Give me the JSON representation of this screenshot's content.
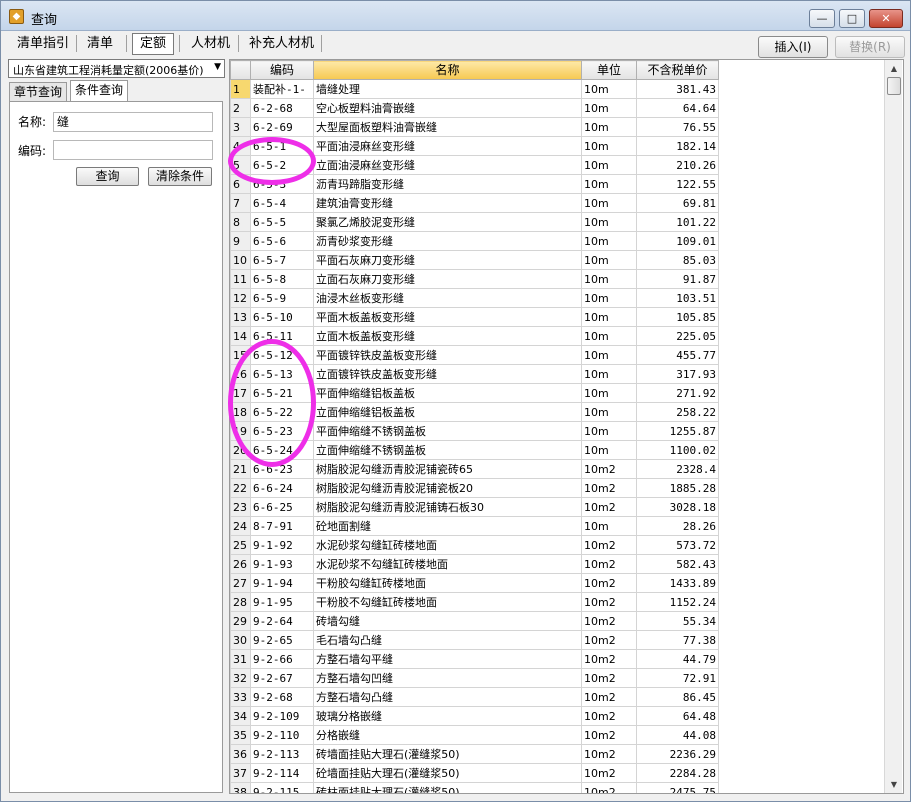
{
  "window": {
    "title": "查询",
    "buttons": {
      "minimize": "—",
      "maximize": "□",
      "close": "✕"
    }
  },
  "toolbar": {
    "tabs": [
      "清单指引",
      "清单",
      "定额",
      "人材机",
      "补充人材机"
    ],
    "active_tab": "定额",
    "insert_label": "插入(I)",
    "replace_label": "替换(R)"
  },
  "left": {
    "library_select": "山东省建筑工程消耗量定额(2006基价)",
    "subtabs": [
      "章节查询",
      "条件查询"
    ],
    "active_subtab": "条件查询",
    "name_label": "名称:",
    "name_value": "缝",
    "code_label": "编码:",
    "code_value": "",
    "query_button": "查询",
    "clear_button": "清除条件"
  },
  "grid": {
    "columns": [
      "",
      "编码",
      "名称",
      "单位",
      "不含税单价"
    ],
    "sorted_column": "名称",
    "rows": [
      {
        "no": "1",
        "code": "装配补-1-",
        "name": "墙缝处理",
        "unit": "10m",
        "price": "381.43"
      },
      {
        "no": "2",
        "code": "6-2-68",
        "name": "空心板塑料油膏嵌缝",
        "unit": "10m",
        "price": "64.64"
      },
      {
        "no": "3",
        "code": "6-2-69",
        "name": "大型屋面板塑料油膏嵌缝",
        "unit": "10m",
        "price": "76.55"
      },
      {
        "no": "4",
        "code": "6-5-1",
        "name": "平面油浸麻丝变形缝",
        "unit": "10m",
        "price": "182.14"
      },
      {
        "no": "5",
        "code": "6-5-2",
        "name": "立面油浸麻丝变形缝",
        "unit": "10m",
        "price": "210.26"
      },
      {
        "no": "6",
        "code": "6-5-3",
        "name": "沥青玛蹄脂变形缝",
        "unit": "10m",
        "price": "122.55"
      },
      {
        "no": "7",
        "code": "6-5-4",
        "name": "建筑油膏变形缝",
        "unit": "10m",
        "price": "69.81"
      },
      {
        "no": "8",
        "code": "6-5-5",
        "name": "聚氯乙烯胶泥变形缝",
        "unit": "10m",
        "price": "101.22"
      },
      {
        "no": "9",
        "code": "6-5-6",
        "name": "沥青砂浆变形缝",
        "unit": "10m",
        "price": "109.01"
      },
      {
        "no": "10",
        "code": "6-5-7",
        "name": "平面石灰麻刀变形缝",
        "unit": "10m",
        "price": "85.03"
      },
      {
        "no": "11",
        "code": "6-5-8",
        "name": "立面石灰麻刀变形缝",
        "unit": "10m",
        "price": "91.87"
      },
      {
        "no": "12",
        "code": "6-5-9",
        "name": "油浸木丝板变形缝",
        "unit": "10m",
        "price": "103.51"
      },
      {
        "no": "13",
        "code": "6-5-10",
        "name": "平面木板盖板变形缝",
        "unit": "10m",
        "price": "105.85"
      },
      {
        "no": "14",
        "code": "6-5-11",
        "name": "立面木板盖板变形缝",
        "unit": "10m",
        "price": "225.05"
      },
      {
        "no": "15",
        "code": "6-5-12",
        "name": "平面镀锌铁皮盖板变形缝",
        "unit": "10m",
        "price": "455.77"
      },
      {
        "no": "16",
        "code": "6-5-13",
        "name": "立面镀锌铁皮盖板变形缝",
        "unit": "10m",
        "price": "317.93"
      },
      {
        "no": "17",
        "code": "6-5-21",
        "name": "平面伸缩缝铝板盖板",
        "unit": "10m",
        "price": "271.92"
      },
      {
        "no": "18",
        "code": "6-5-22",
        "name": "立面伸缩缝铝板盖板",
        "unit": "10m",
        "price": "258.22"
      },
      {
        "no": "19",
        "code": "6-5-23",
        "name": "平面伸缩缝不锈钢盖板",
        "unit": "10m",
        "price": "1255.87"
      },
      {
        "no": "20",
        "code": "6-5-24",
        "name": "立面伸缩缝不锈钢盖板",
        "unit": "10m",
        "price": "1100.02"
      },
      {
        "no": "21",
        "code": "6-6-23",
        "name": "树脂胶泥勾缝沥青胶泥铺瓷砖65",
        "unit": "10m2",
        "price": "2328.4"
      },
      {
        "no": "22",
        "code": "6-6-24",
        "name": "树脂胶泥勾缝沥青胶泥铺瓷板20",
        "unit": "10m2",
        "price": "1885.28"
      },
      {
        "no": "23",
        "code": "6-6-25",
        "name": "树脂胶泥勾缝沥青胶泥铺铸石板30",
        "unit": "10m2",
        "price": "3028.18"
      },
      {
        "no": "24",
        "code": "8-7-91",
        "name": "砼地面割缝",
        "unit": "10m",
        "price": "28.26"
      },
      {
        "no": "25",
        "code": "9-1-92",
        "name": "水泥砂浆勾缝缸砖楼地面",
        "unit": "10m2",
        "price": "573.72"
      },
      {
        "no": "26",
        "code": "9-1-93",
        "name": "水泥砂浆不勾缝缸砖楼地面",
        "unit": "10m2",
        "price": "582.43"
      },
      {
        "no": "27",
        "code": "9-1-94",
        "name": "干粉胶勾缝缸砖楼地面",
        "unit": "10m2",
        "price": "1433.89"
      },
      {
        "no": "28",
        "code": "9-1-95",
        "name": "干粉胶不勾缝缸砖楼地面",
        "unit": "10m2",
        "price": "1152.24"
      },
      {
        "no": "29",
        "code": "9-2-64",
        "name": "砖墙勾缝",
        "unit": "10m2",
        "price": "55.34"
      },
      {
        "no": "30",
        "code": "9-2-65",
        "name": "毛石墙勾凸缝",
        "unit": "10m2",
        "price": "77.38"
      },
      {
        "no": "31",
        "code": "9-2-66",
        "name": "方整石墙勾平缝",
        "unit": "10m2",
        "price": "44.79"
      },
      {
        "no": "32",
        "code": "9-2-67",
        "name": "方整石墙勾凹缝",
        "unit": "10m2",
        "price": "72.91"
      },
      {
        "no": "33",
        "code": "9-2-68",
        "name": "方整石墙勾凸缝",
        "unit": "10m2",
        "price": "86.45"
      },
      {
        "no": "34",
        "code": "9-2-109",
        "name": "玻璃分格嵌缝",
        "unit": "10m2",
        "price": "64.48"
      },
      {
        "no": "35",
        "code": "9-2-110",
        "name": "分格嵌缝",
        "unit": "10m2",
        "price": "44.08"
      },
      {
        "no": "36",
        "code": "9-2-113",
        "name": "砖墙面挂贴大理石(灌缝浆50)",
        "unit": "10m2",
        "price": "2236.29"
      },
      {
        "no": "37",
        "code": "9-2-114",
        "name": "砼墙面挂贴大理石(灌缝浆50)",
        "unit": "10m2",
        "price": "2284.28"
      },
      {
        "no": "38",
        "code": "9-2-115",
        "name": "砖柱面挂贴大理石(灌缝浆50)",
        "unit": "10m2",
        "price": "2475.75"
      }
    ]
  },
  "annotation_color": "#ee2ee8"
}
